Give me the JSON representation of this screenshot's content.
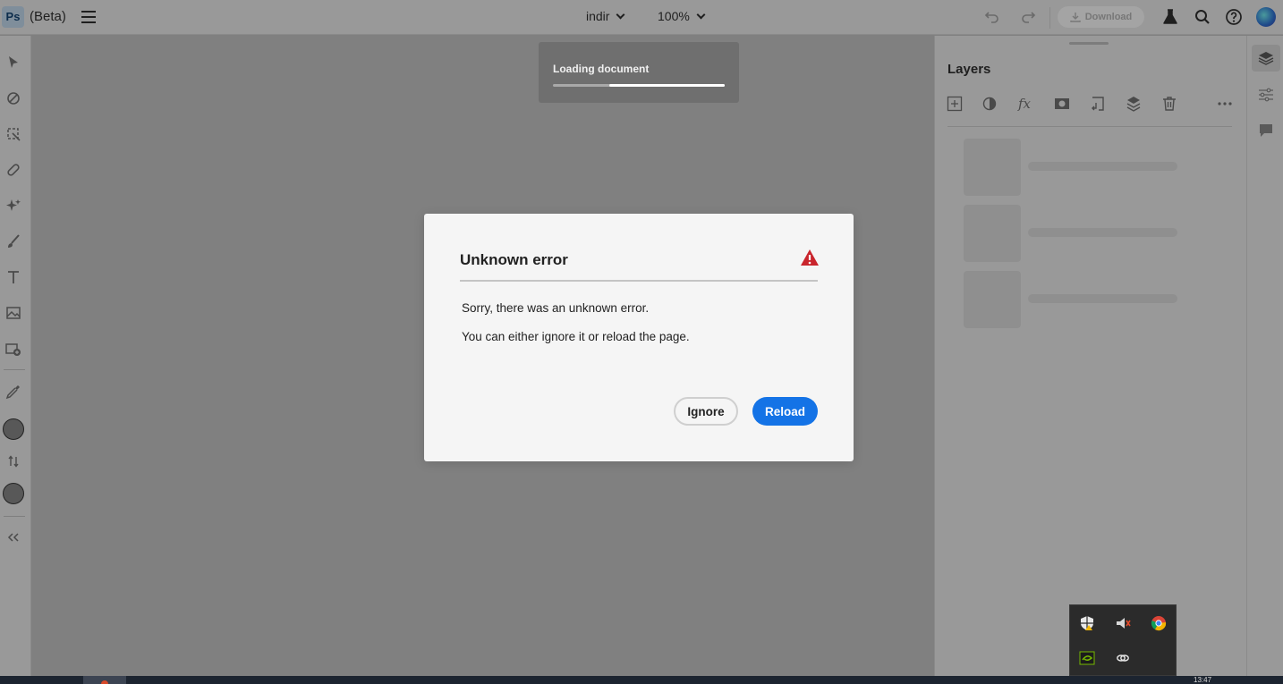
{
  "app": {
    "logo": "Ps",
    "beta_label": "(Beta)",
    "document_name": "indir",
    "zoom": "100%",
    "download_label": "Download"
  },
  "icons": {
    "topbar": [
      "menu-icon",
      "undo-icon",
      "redo-icon",
      "download-icon",
      "flask-icon",
      "search-icon",
      "help-icon"
    ],
    "left_toolbar": [
      "select-icon",
      "eraser-icon",
      "crop-icon",
      "healing-icon",
      "generative-icon",
      "brush-icon",
      "type-icon",
      "image-icon",
      "add-image-icon",
      "eyedropper-icon",
      "swap-colors-icon",
      "collapse-icon"
    ],
    "layers_toolbar": [
      "add-layer-icon",
      "adjustment-icon",
      "fx-icon",
      "mask-icon",
      "clip-icon",
      "merge-icon",
      "trash-icon",
      "more-icon"
    ],
    "right_strip": [
      "layers-icon",
      "properties-icon",
      "comments-icon"
    ],
    "tray": [
      "security-icon",
      "volume-icon",
      "chrome-icon",
      "nvidia-icon",
      "link-icon"
    ]
  },
  "colors": {
    "accent": "#1473e6",
    "alert": "#c9252d",
    "overlay": "#808080"
  },
  "loading": {
    "text": "Loading document",
    "progress_fraction": 0.67
  },
  "layers": {
    "title": "Layers",
    "placeholders": 3
  },
  "dialog": {
    "title": "Unknown error",
    "line1": "Sorry, there was an unknown error.",
    "line2": "You can either ignore it or reload the page.",
    "ignore_label": "Ignore",
    "reload_label": "Reload"
  },
  "taskbar": {
    "clock": "13:47"
  }
}
